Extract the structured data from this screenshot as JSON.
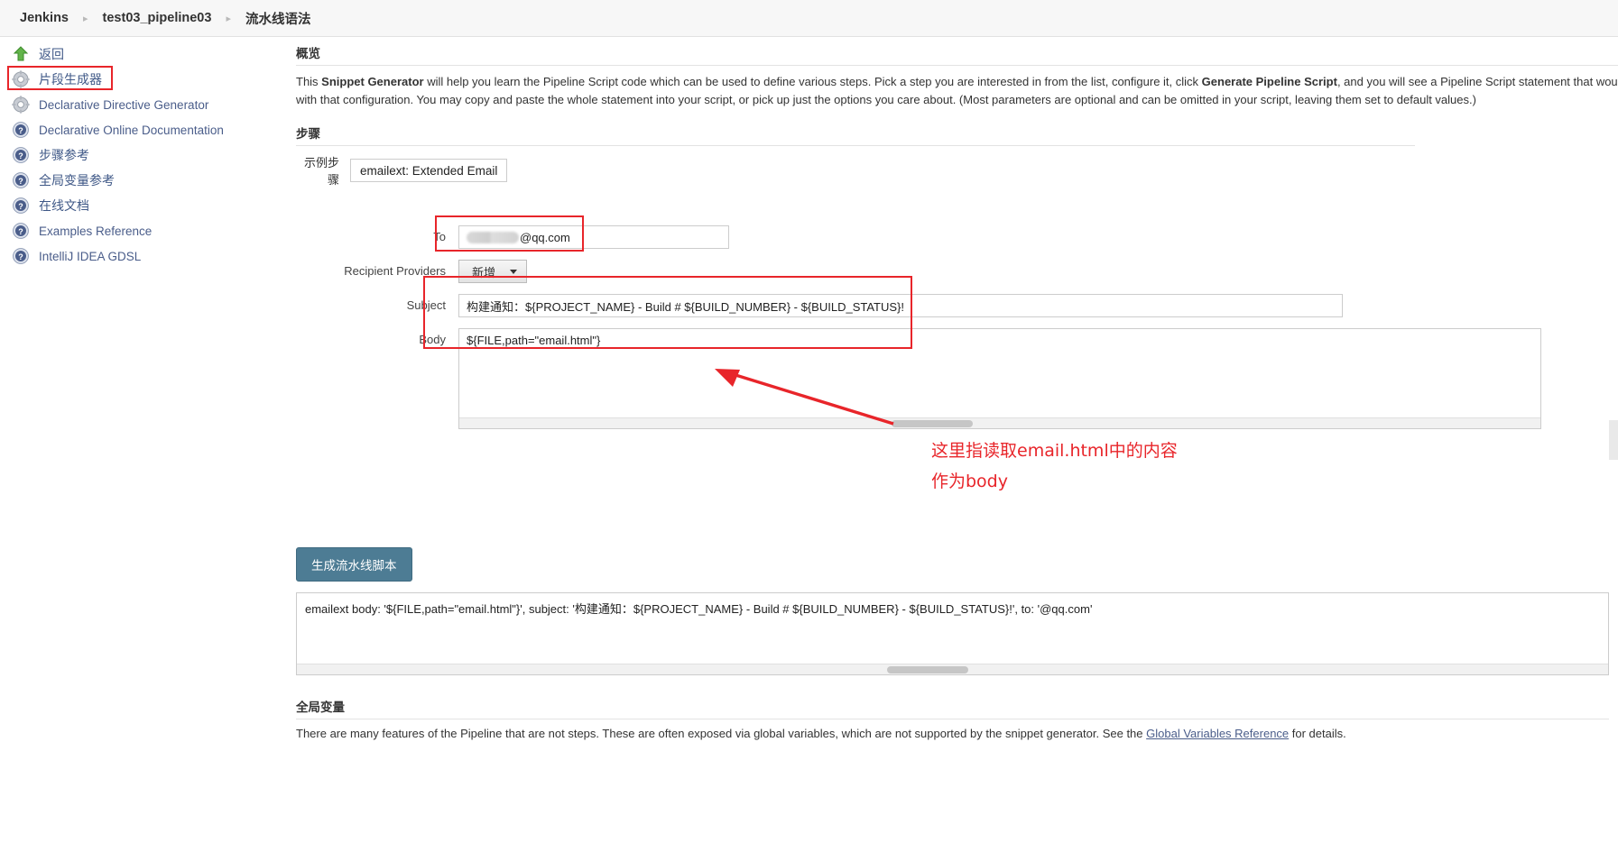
{
  "breadcrumb": {
    "items": [
      {
        "label": "Jenkins"
      },
      {
        "label": "test03_pipeline03"
      },
      {
        "label": "流水线语法"
      }
    ]
  },
  "sidebar": {
    "items": [
      {
        "label": "返回",
        "icon": "up-arrow-icon"
      },
      {
        "label": "片段生成器",
        "icon": "gear-icon",
        "highlighted": true
      },
      {
        "label": "Declarative Directive Generator",
        "icon": "gear-icon"
      },
      {
        "label": "Declarative Online Documentation",
        "icon": "help-icon"
      },
      {
        "label": "步骤参考",
        "icon": "help-icon"
      },
      {
        "label": "全局变量参考",
        "icon": "help-icon"
      },
      {
        "label": "在线文档",
        "icon": "help-icon"
      },
      {
        "label": "Examples Reference",
        "icon": "help-icon"
      },
      {
        "label": "IntelliJ IDEA GDSL",
        "icon": "help-icon"
      }
    ]
  },
  "main": {
    "overview_title": "概览",
    "overview_text_1": "This ",
    "overview_bold_1": "Snippet Generator",
    "overview_text_2": " will help you learn the Pipeline Script code which can be used to define various steps. Pick a step you are interested in from the list, configure it, click ",
    "overview_bold_2": "Generate Pipeline Script",
    "overview_text_3": ", and you will see a Pipeline Script statement that would call the step with that configuration. You may copy and paste the whole statement into your script, or pick up just the options you care about. (Most parameters are optional and can be omitted in your script, leaving them set to default values.)",
    "steps_title": "步骤",
    "sample_step_label": "示例步骤",
    "sample_step_value": "emailext: Extended Email",
    "form": {
      "to_label": "To",
      "to_value": "@qq.com",
      "recipient_providers_label": "Recipient Providers",
      "add_button_label": "新增",
      "subject_label": "Subject",
      "subject_value": "构建通知：${PROJECT_NAME} - Build # ${BUILD_NUMBER} - ${BUILD_STATUS}!",
      "body_label": "Body",
      "body_value": "${FILE,path=\"email.html\"}"
    },
    "annotation": {
      "line1": "这里指读取email.html中的内容",
      "line2": "作为body",
      "color": "#e8252a"
    },
    "generate_button_label": "生成流水线脚本",
    "generated_script": "emailext body: '${FILE,path=\"email.html\"}', subject: '构建通知：${PROJECT_NAME} - Build # ${BUILD_NUMBER} - ${BUILD_STATUS}!', to: '@qq.com'",
    "globals_title": "全局变量",
    "globals_text_1": "There are many features of the Pipeline that are not steps. These are often exposed via global variables, which are not supported by the snippet generator. See the ",
    "globals_link": "Global Variables Reference",
    "globals_text_2": " for details."
  }
}
